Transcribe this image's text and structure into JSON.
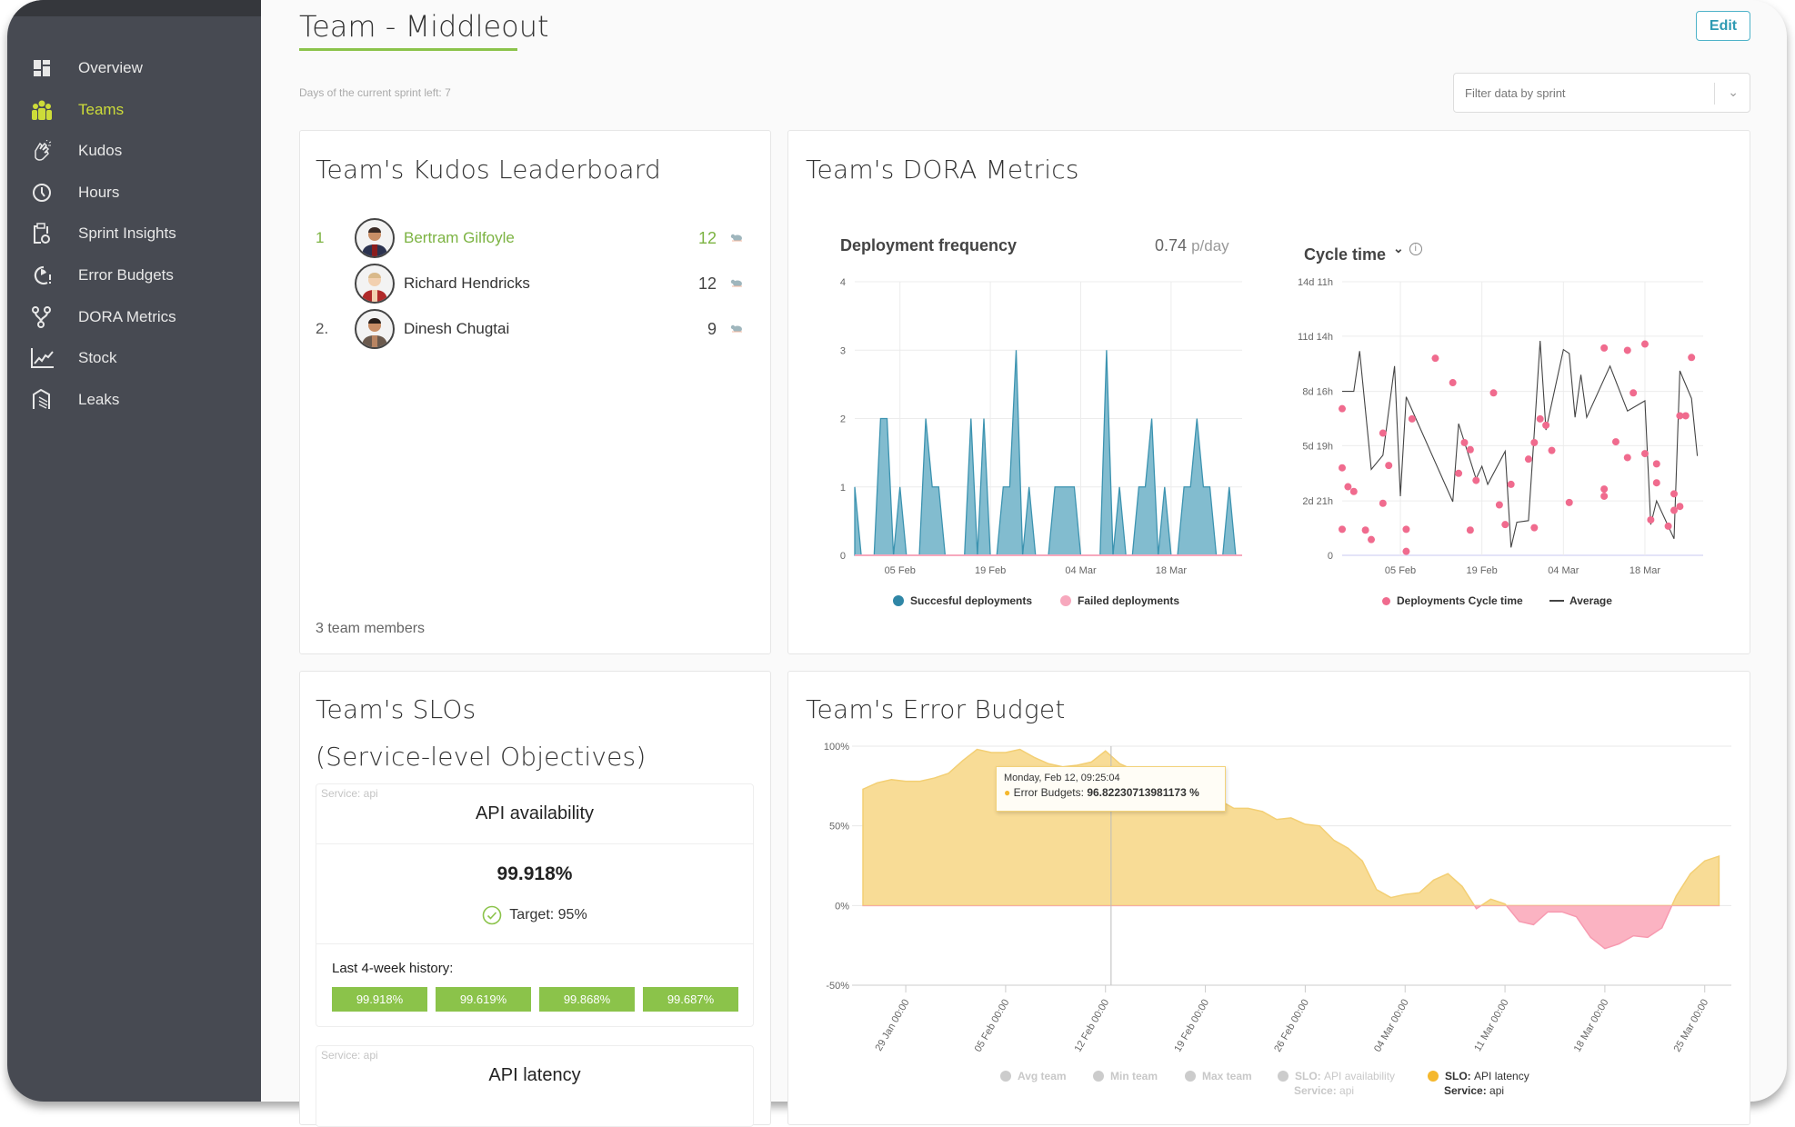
{
  "sidebar": {
    "items": [
      {
        "label": "Overview",
        "icon": "dashboard-icon"
      },
      {
        "label": "Teams",
        "icon": "team-icon",
        "active": true
      },
      {
        "label": "Kudos",
        "icon": "clapping-hands-icon"
      },
      {
        "label": "Hours",
        "icon": "clock-icon"
      },
      {
        "label": "Sprint Insights",
        "icon": "clipboard-icon"
      },
      {
        "label": "Error Budgets",
        "icon": "gauge-alert-icon"
      },
      {
        "label": "DORA Metrics",
        "icon": "branch-icon"
      },
      {
        "label": "Stock",
        "icon": "line-chart-icon"
      },
      {
        "label": "Leaks",
        "icon": "leak-icon"
      }
    ]
  },
  "header": {
    "title": "Team - Middleout",
    "edit_label": "Edit",
    "sprint_left": "Days of the current sprint left: 7",
    "filter_placeholder": "Filter data by sprint"
  },
  "kudos": {
    "title": "Team's Kudos Leaderboard",
    "rows": [
      {
        "rank": "1",
        "name": "Bertram Gilfoyle",
        "count": "12",
        "highlight": true
      },
      {
        "rank": "",
        "name": "Richard Hendricks",
        "count": "12"
      },
      {
        "rank": "2.",
        "name": "Dinesh Chugtai",
        "count": "9"
      }
    ],
    "footer": "3 team members"
  },
  "dora": {
    "title": "Team's DORA Metrics",
    "deploy_title": "Deployment frequency",
    "deploy_value": "0.74",
    "deploy_unit": "p/day",
    "cycle_title": "Cycle time",
    "legend_success": "Succesful deployments",
    "legend_failed": "Failed deployments",
    "legend_cycle": "Deployments Cycle time",
    "legend_avg": "Average"
  },
  "slo": {
    "title1": "Team's SLOs",
    "title2": "(Service-level Objectives)",
    "items": [
      {
        "service": "Service: api",
        "name": "API availability",
        "value": "99.918%",
        "target": "Target: 95%",
        "history_label": "Last 4-week history:",
        "history": [
          "99.918%",
          "99.619%",
          "99.868%",
          "99.687%"
        ]
      },
      {
        "service": "Service: api",
        "name": "API latency"
      }
    ]
  },
  "error_budget": {
    "title": "Team's Error Budget",
    "tooltip_date": "Monday, Feb 12, 09:25:04",
    "tooltip_label": "Error Budgets:",
    "tooltip_value": "96.82230713981173 %",
    "legend": [
      {
        "label": "Avg team",
        "active": false
      },
      {
        "label": "Min team",
        "active": false
      },
      {
        "label": "Max team",
        "active": false
      },
      {
        "label": "SLO:",
        "label2": "API availability",
        "sub": "Service:",
        "sub2": "api",
        "active": false
      },
      {
        "label": "SLO:",
        "label2": "API latency",
        "sub": "Service:",
        "sub2": "api",
        "active": true
      }
    ]
  },
  "colors": {
    "accent": "#8bc34a",
    "nav_active": "#cddc39",
    "sidebar": "#474a52",
    "deploy": "#3c93b0",
    "failed": "#f7a8bd",
    "cycle": "#f06b8e",
    "budget_pos": "#f8dc96",
    "budget_neg": "#fbb3c2"
  },
  "chart_data": [
    {
      "type": "area",
      "title": "Deployment frequency",
      "ylim": [
        0,
        4
      ],
      "yticks": [
        "0",
        "1",
        "2",
        "3",
        "4"
      ],
      "xticks": [
        "05 Feb",
        "19 Feb",
        "04 Mar",
        "18 Mar"
      ],
      "grid": true,
      "legend": "bottom",
      "series": [
        {
          "name": "Succesful deployments",
          "x": [
            "29 Jan",
            "30 Jan",
            "31 Jan",
            "01 Feb",
            "02 Feb",
            "03 Feb",
            "04 Feb",
            "05 Feb",
            "06 Feb",
            "07 Feb",
            "08 Feb",
            "09 Feb",
            "10 Feb",
            "11 Feb",
            "12 Feb",
            "13 Feb",
            "14 Feb",
            "15 Feb",
            "16 Feb",
            "17 Feb",
            "18 Feb",
            "19 Feb",
            "20 Feb",
            "21 Feb",
            "22 Feb",
            "23 Feb",
            "24 Feb",
            "25 Feb",
            "26 Feb",
            "27 Feb",
            "28 Feb",
            "29 Feb",
            "01 Mar",
            "02 Mar",
            "03 Mar",
            "04 Mar",
            "05 Mar",
            "06 Mar",
            "07 Mar",
            "08 Mar",
            "09 Mar",
            "10 Mar",
            "11 Mar",
            "12 Mar",
            "13 Mar",
            "14 Mar",
            "15 Mar",
            "16 Mar",
            "17 Mar",
            "18 Mar",
            "19 Mar",
            "20 Mar",
            "21 Mar",
            "22 Mar",
            "23 Mar",
            "24 Mar",
            "25 Mar",
            "26 Mar",
            "27 Mar",
            "28 Mar"
          ],
          "values": [
            1,
            0,
            0,
            0,
            2,
            2,
            0,
            1,
            0,
            0,
            0,
            2,
            1,
            1,
            0,
            0,
            0,
            0,
            2,
            0,
            2,
            0,
            0,
            1,
            1,
            3,
            0,
            1,
            0,
            0,
            0,
            1,
            1,
            1,
            1,
            0,
            0,
            0,
            0,
            3,
            0,
            1,
            0,
            0,
            1,
            1,
            2,
            0,
            1,
            0,
            0,
            1,
            1,
            2,
            1,
            1,
            0,
            0,
            1,
            0
          ]
        },
        {
          "name": "Failed deployments",
          "values": []
        }
      ]
    },
    {
      "type": "scatter",
      "title": "Cycle time",
      "unit": "hours",
      "ylim": [
        0,
        347
      ],
      "yticks": [
        {
          "label": "0",
          "value": 0
        },
        {
          "label": "2d 21h",
          "value": 69
        },
        {
          "label": "5d 19h",
          "value": 139
        },
        {
          "label": "8d 16h",
          "value": 208
        },
        {
          "label": "11d 14h",
          "value": 278
        },
        {
          "label": "14d 11h",
          "value": 347
        }
      ],
      "xticks": [
        "05 Feb",
        "19 Feb",
        "04 Mar",
        "18 Mar"
      ],
      "grid": true,
      "legend": "bottom",
      "series": [
        {
          "name": "Deployments Cycle time",
          "points": [
            [
              "26 Jan",
              186
            ],
            [
              "26 Jan",
              111
            ],
            [
              "27 Jan",
              87
            ],
            [
              "26 Jan",
              33
            ],
            [
              "28 Jan",
              81
            ],
            [
              "30 Jan",
              32
            ],
            [
              "31 Jan",
              20
            ],
            [
              "02 Feb",
              155
            ],
            [
              "02 Feb",
              66
            ],
            [
              "03 Feb",
              114
            ],
            [
              "06 Feb",
              33
            ],
            [
              "06 Feb",
              5
            ],
            [
              "07 Feb",
              173
            ],
            [
              "11 Feb",
              250
            ],
            [
              "14 Feb",
              219
            ],
            [
              "15 Feb",
              104
            ],
            [
              "16 Feb",
              143
            ],
            [
              "17 Feb",
              134
            ],
            [
              "17 Feb",
              32
            ],
            [
              "18 Feb",
              95
            ],
            [
              "21 Feb",
              206
            ],
            [
              "22 Feb",
              64
            ],
            [
              "23 Feb",
              39
            ],
            [
              "24 Feb",
              90
            ],
            [
              "27 Feb",
              122
            ],
            [
              "28 Feb",
              143
            ],
            [
              "28 Feb",
              35
            ],
            [
              "29 Feb",
              173
            ],
            [
              "01 Mar",
              165
            ],
            [
              "02 Mar",
              133
            ],
            [
              "05 Mar",
              67
            ],
            [
              "11 Mar",
              263
            ],
            [
              "11 Mar",
              84
            ],
            [
              "11 Mar",
              75
            ],
            [
              "13 Mar",
              144
            ],
            [
              "15 Mar",
              124
            ],
            [
              "15 Mar",
              260
            ],
            [
              "16 Mar",
              206
            ],
            [
              "18 Mar",
              129
            ],
            [
              "18 Mar",
              268
            ],
            [
              "19 Mar",
              45
            ],
            [
              "20 Mar",
              116
            ],
            [
              "20 Mar",
              92
            ],
            [
              "22 Mar",
              37
            ],
            [
              "23 Mar",
              78
            ],
            [
              "23 Mar",
              57
            ],
            [
              "24 Mar",
              62
            ],
            [
              "24 Mar",
              177
            ],
            [
              "25 Mar",
              177
            ],
            [
              "26 Mar",
              251
            ]
          ]
        },
        {
          "name": "Average",
          "points": [
            [
              "26 Jan",
              208
            ],
            [
              "28 Jan",
              208
            ],
            [
              "29 Jan",
              259
            ],
            [
              "31 Jan",
              109
            ],
            [
              "02 Feb",
              127
            ],
            [
              "04 Feb",
              240
            ],
            [
              "05 Feb",
              75
            ],
            [
              "06 Feb",
              201
            ],
            [
              "14 Feb",
              68
            ],
            [
              "15 Feb",
              167
            ],
            [
              "18 Feb",
              97
            ],
            [
              "19 Feb",
              113
            ],
            [
              "20 Feb",
              90
            ],
            [
              "23 Feb",
              132
            ],
            [
              "24 Feb",
              10
            ],
            [
              "25 Feb",
              42
            ],
            [
              "27 Feb",
              44
            ],
            [
              "28 Feb",
              156
            ],
            [
              "29 Feb",
              272
            ],
            [
              "01 Mar",
              159
            ],
            [
              "04 Mar",
              261
            ],
            [
              "05 Mar",
              256
            ],
            [
              "06 Mar",
              175
            ],
            [
              "07 Mar",
              229
            ],
            [
              "08 Mar",
              175
            ],
            [
              "12 Mar",
              240
            ],
            [
              "15 Mar",
              183
            ],
            [
              "18 Mar",
              196
            ],
            [
              "19 Mar",
              39
            ],
            [
              "20 Mar",
              69
            ],
            [
              "23 Mar",
              21
            ],
            [
              "24 Mar",
              234
            ],
            [
              "26 Mar",
              199
            ],
            [
              "27 Mar",
              126
            ]
          ]
        }
      ]
    },
    {
      "type": "area",
      "title": "Team's Error Budget",
      "ylim": [
        -50,
        100
      ],
      "yticks": [
        "100%",
        "50%",
        "0%",
        "-50%"
      ],
      "xticks": [
        "29 Jan 00:00",
        "05 Feb 00:00",
        "12 Feb 00:00",
        "19 Feb 00:00",
        "26 Feb 00:00",
        "04 Mar 00:00",
        "11 Mar 00:00",
        "18 Mar 00:00",
        "25 Mar 00:00"
      ],
      "grid": true,
      "legend": "bottom",
      "series": [
        {
          "name": "SLO: API latency",
          "x": [
            "26 Jan",
            "27 Jan",
            "28 Jan",
            "29 Jan",
            "30 Jan",
            "31 Jan",
            "01 Feb",
            "02 Feb",
            "03 Feb",
            "04 Feb",
            "05 Feb",
            "06 Feb",
            "07 Feb",
            "08 Feb",
            "09 Feb",
            "10 Feb",
            "11 Feb",
            "12 Feb",
            "13 Feb",
            "14 Feb",
            "15 Feb",
            "16 Feb",
            "17 Feb",
            "18 Feb",
            "19 Feb",
            "20 Feb",
            "21 Feb",
            "22 Feb",
            "23 Feb",
            "24 Feb",
            "25 Feb",
            "26 Feb",
            "27 Feb",
            "28 Feb",
            "29 Feb",
            "01 Mar",
            "02 Mar",
            "03 Mar",
            "04 Mar",
            "05 Mar",
            "06 Mar",
            "07 Mar",
            "08 Mar",
            "09 Mar",
            "10 Mar",
            "11 Mar",
            "12 Mar",
            "13 Mar",
            "14 Mar",
            "15 Mar",
            "16 Mar",
            "17 Mar",
            "18 Mar",
            "19 Mar",
            "20 Mar",
            "21 Mar",
            "22 Mar",
            "23 Mar",
            "24 Mar",
            "25 Mar",
            "26 Mar"
          ],
          "values": [
            73,
            77,
            79,
            78,
            78,
            80,
            83,
            91,
            98,
            96,
            96,
            98,
            93,
            89,
            87,
            88,
            90,
            97,
            89,
            85,
            84,
            82,
            80,
            76,
            72,
            66,
            61,
            61,
            59,
            54,
            55,
            51,
            50,
            41,
            36,
            28,
            10,
            5,
            7,
            8,
            16,
            20,
            12,
            -2,
            4,
            1,
            -10,
            -12,
            -4,
            -4,
            -7,
            -20,
            -27,
            -24,
            -19,
            -20,
            -14,
            6,
            20,
            28,
            31
          ]
        }
      ]
    }
  ]
}
